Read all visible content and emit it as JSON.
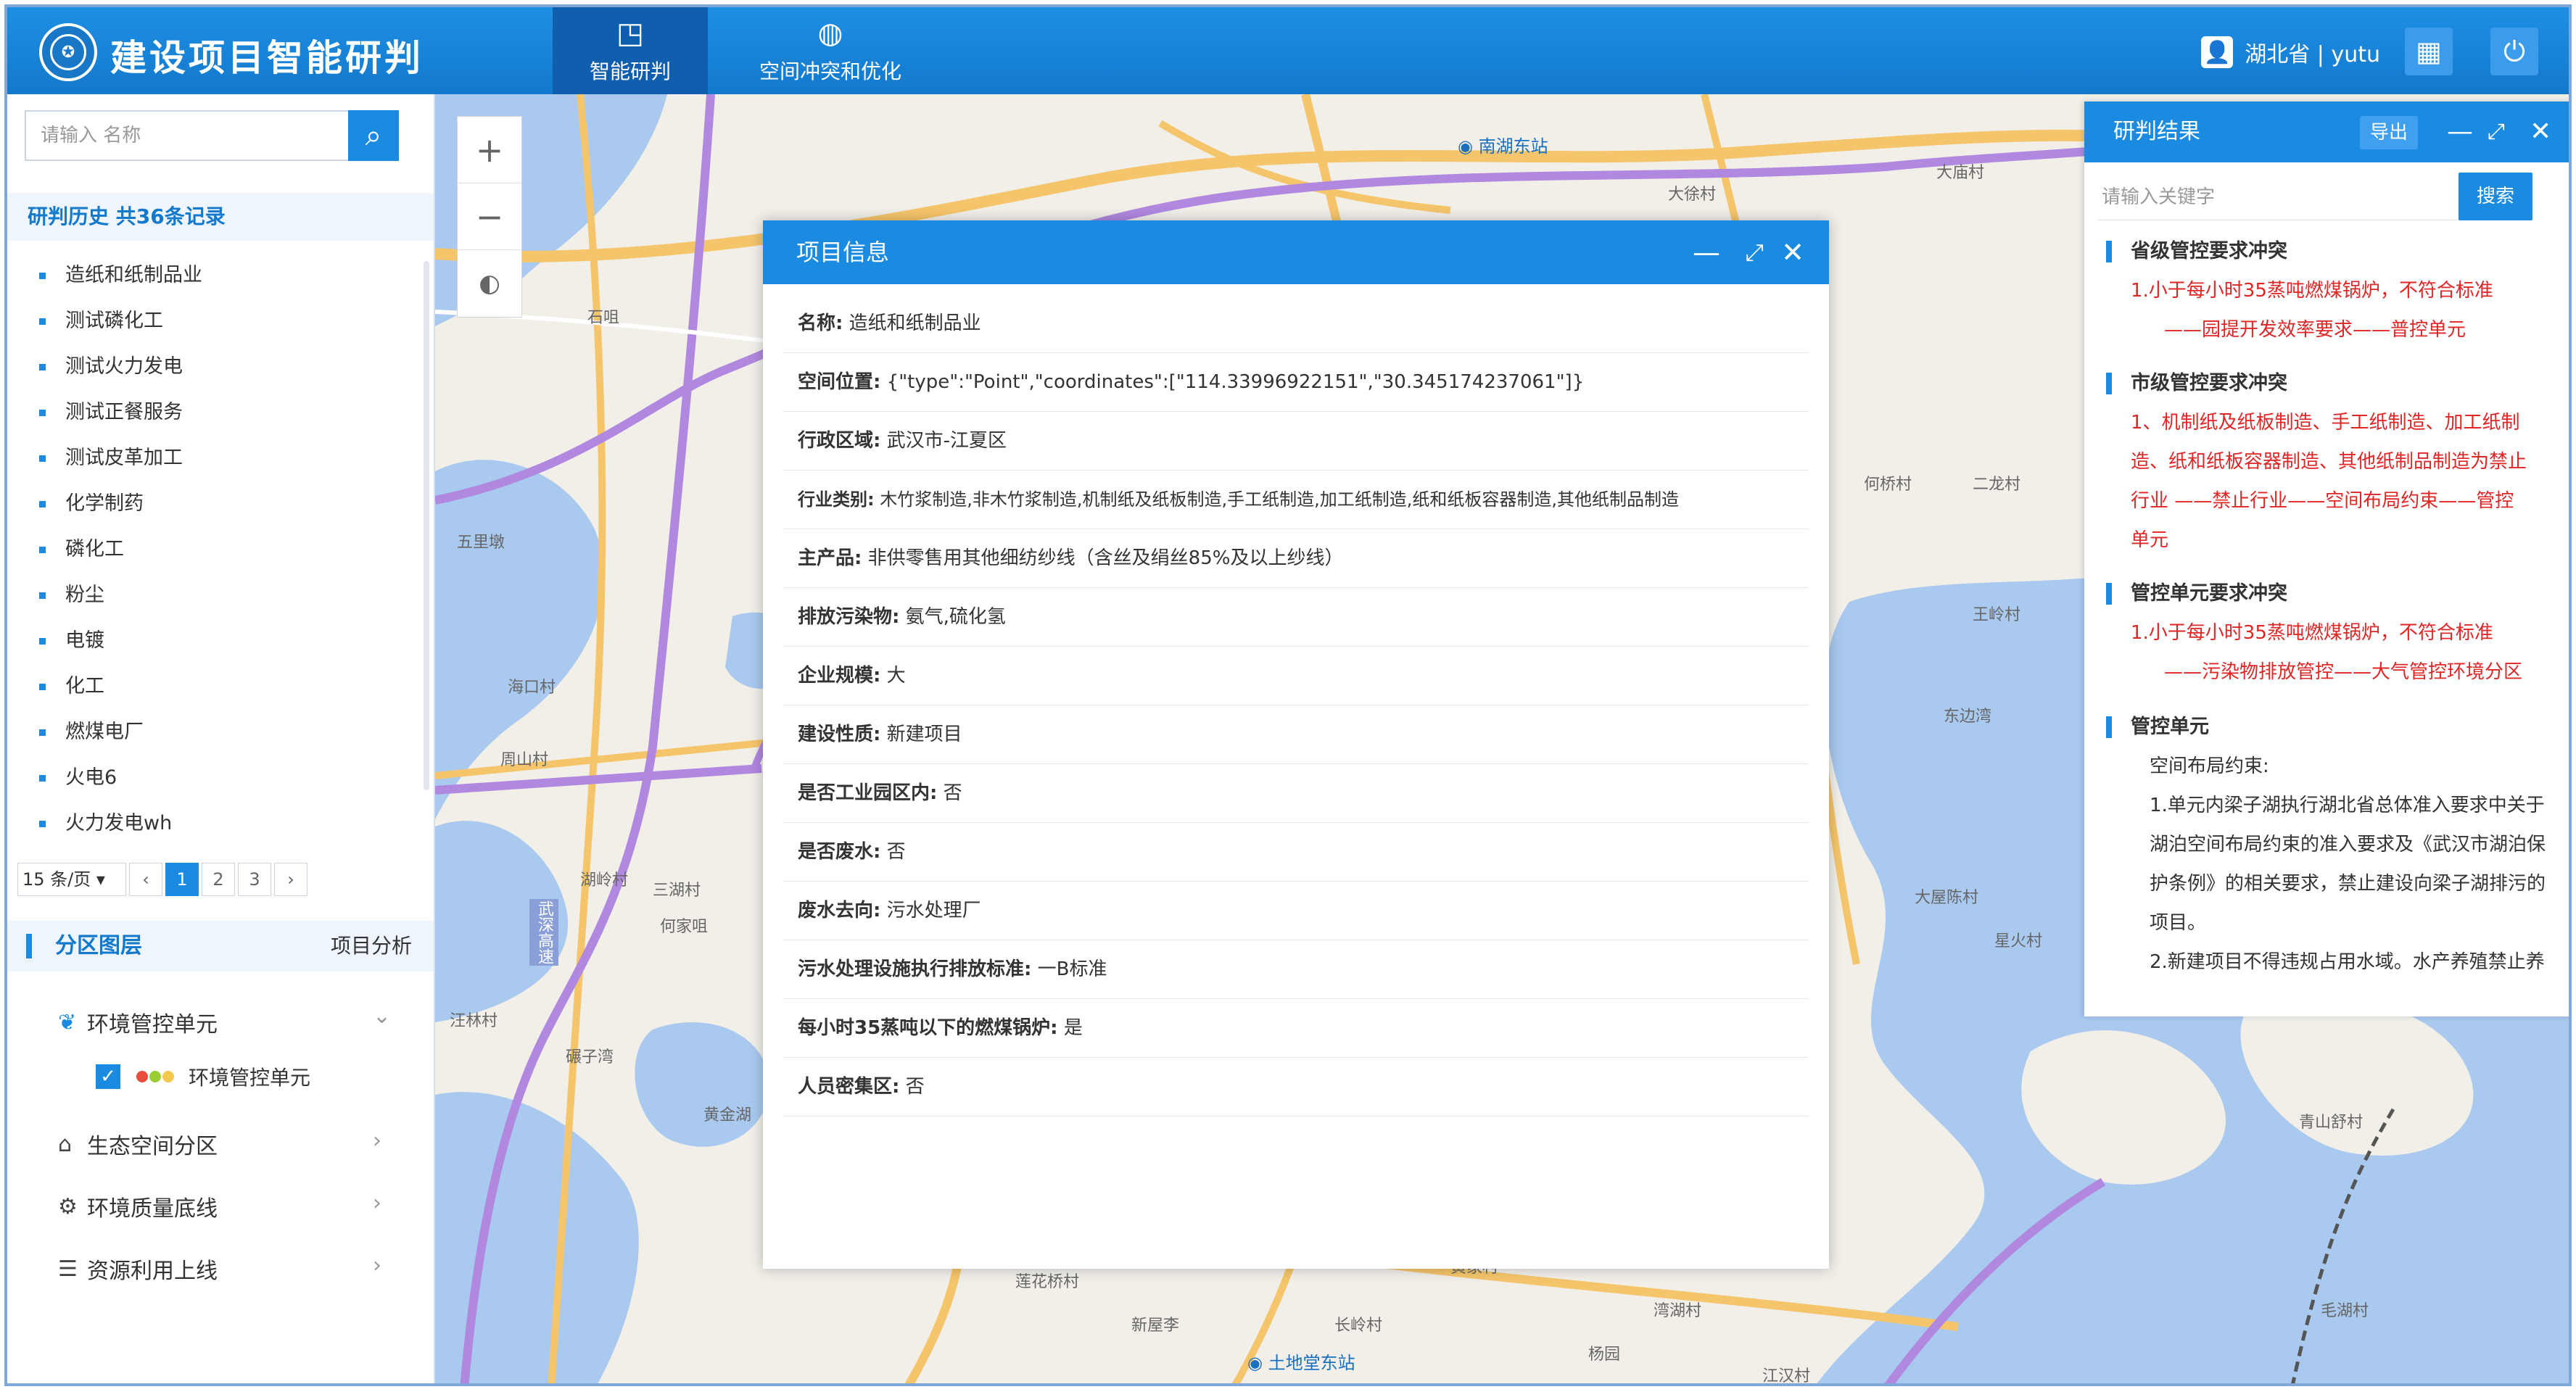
{
  "header": {
    "title": "建设项目智能研判",
    "tabs": [
      {
        "label": "智能研判",
        "icon": "presentation-icon"
      },
      {
        "label": "空间冲突和优化",
        "icon": "globe-icon"
      }
    ],
    "user": "湖北省 | yutu"
  },
  "left": {
    "search_placeholder": "请输入 名称",
    "history_title": "研判历史 共36条记录",
    "history_items": [
      "造纸和纸制品业",
      "测试磷化工",
      "测试火力发电",
      "测试正餐服务",
      "测试皮革加工",
      "化学制药",
      "磷化工",
      "粉尘",
      "电镀",
      "化工",
      "燃煤电厂",
      "火电6",
      "火力发电wh"
    ],
    "pager": {
      "page_size": "15 条/页",
      "pages": [
        "1",
        "2",
        "3"
      ],
      "prev": "‹",
      "next": "›"
    },
    "layers_title": "分区图层",
    "analysis_label": "项目分析",
    "layers": [
      {
        "label": "环境管控单元",
        "icon": "leaf-icon",
        "arrow": "⌄"
      },
      {
        "label": "生态空间分区",
        "icon": "building-icon",
        "arrow": "›"
      },
      {
        "label": "环境质量底线",
        "icon": "factory-icon",
        "arrow": "›"
      },
      {
        "label": "资源利用上线",
        "icon": "stack-icon",
        "arrow": "›"
      }
    ],
    "sub_layer": "环境管控单元",
    "legend_colors": [
      "#e84c3d",
      "#9acd32",
      "#f2c94c"
    ]
  },
  "map": {
    "labels": [
      {
        "text": "南湖东站",
        "icon": true
      },
      {
        "text": "土地堂东站",
        "icon": true
      },
      {
        "text": "武深高速"
      },
      {
        "text": "三湖村"
      },
      {
        "text": "何家咀"
      },
      {
        "text": "湖岭村"
      },
      {
        "text": "五里墩"
      },
      {
        "text": "黄金湖"
      },
      {
        "text": "石咀"
      },
      {
        "text": "海口村"
      },
      {
        "text": "周山村"
      },
      {
        "text": "碾子湾"
      },
      {
        "text": "大徐村"
      },
      {
        "text": "大庙村"
      },
      {
        "text": "二龙村"
      },
      {
        "text": "何桥村"
      },
      {
        "text": "王岭村"
      },
      {
        "text": "东边湾"
      },
      {
        "text": "大屋陈村"
      },
      {
        "text": "星火村"
      },
      {
        "text": "青山舒村"
      },
      {
        "text": "毛湖村"
      },
      {
        "text": "新屋李"
      },
      {
        "text": "长岭村"
      },
      {
        "text": "莲花桥村"
      },
      {
        "text": "湾湖村"
      },
      {
        "text": "黄家村"
      },
      {
        "text": "杨园"
      },
      {
        "text": "汪林村"
      },
      {
        "text": "江汉村"
      }
    ]
  },
  "dialog": {
    "title": "项目信息",
    "rows": [
      {
        "k": "名称:",
        "v": "造纸和纸制品业"
      },
      {
        "k": "空间位置:",
        "v": "{\"type\":\"Point\",\"coordinates\":[\"114.33996922151\",\"30.345174237061\"]}"
      },
      {
        "k": "行政区域:",
        "v": "武汉市-江夏区"
      },
      {
        "k": "行业类别:",
        "v": "木竹浆制造,非木竹浆制造,机制纸及纸板制造,手工纸制造,加工纸制造,纸和纸板容器制造,其他纸制品制造"
      },
      {
        "k": "主产品:",
        "v": "非供零售用其他细纺纱线（含丝及绢丝85%及以上纱线）"
      },
      {
        "k": "排放污染物:",
        "v": "氨气,硫化氢"
      },
      {
        "k": "企业规模:",
        "v": "大"
      },
      {
        "k": "建设性质:",
        "v": "新建项目"
      },
      {
        "k": "是否工业园区内:",
        "v": "否"
      },
      {
        "k": "是否废水:",
        "v": "否"
      },
      {
        "k": "废水去向:",
        "v": "污水处理厂"
      },
      {
        "k": "污水处理设施执行排放标准:",
        "v": "一B标准"
      },
      {
        "k": "每小时35蒸吨以下的燃煤锅炉:",
        "v": "是"
      },
      {
        "k": "人员密集区:",
        "v": "否"
      }
    ]
  },
  "result": {
    "title": "研判结果",
    "export_label": "导出",
    "search_placeholder": "请输入关键字",
    "search_btn": "搜索",
    "sections": [
      {
        "title": "省级管控要求冲突",
        "lines": [
          "1.小于每小时35蒸吨燃煤锅炉，不符合标准",
          "——园提开发效率要求——普控单元"
        ]
      },
      {
        "title": "市级管控要求冲突",
        "lines": [
          "1、机制纸及纸板制造、手工纸制造、加工纸制",
          "造、纸和纸板容器制造、其他纸制品制造为禁止",
          "行业 ——禁止行业——空间布局约束——管控",
          "单元"
        ]
      },
      {
        "title": "管控单元要求冲突",
        "lines": [
          "1.小于每小时35蒸吨燃煤锅炉，不符合标准",
          "——污染物排放管控——大气管控环境分区"
        ]
      },
      {
        "title": "管控单元",
        "lines": [
          "空间布局约束:",
          "1.单元内梁子湖执行湖北省总体准入要求中关于",
          "湖泊空间布局约束的准入要求及《武汉市湖泊保",
          "护条例》的相关要求，禁止建设向梁子湖排污的",
          "项目。",
          "2.新建项目不得违规占用水域。水产养殖禁止养"
        ]
      }
    ]
  }
}
